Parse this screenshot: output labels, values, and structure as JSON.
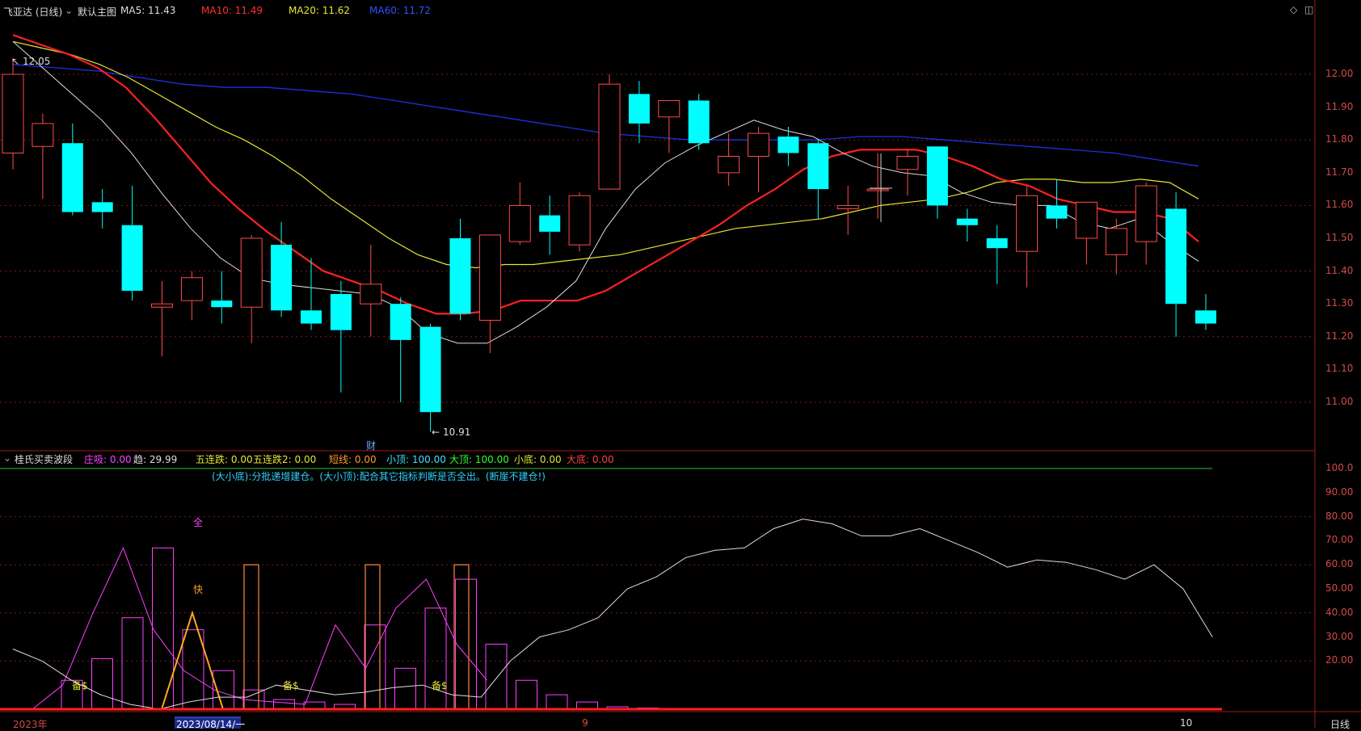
{
  "colors": {
    "up": "#ff4a4a",
    "down": "#00ffff",
    "ma5": "#dddddd",
    "ma10": "#ff2020",
    "ma20": "#e5e530",
    "ma60": "#2030e0",
    "grid": "#7a1a1a",
    "bg": "#000000"
  },
  "header": {
    "stock": "飞亚达 (日线)",
    "main_chart": "默认主图",
    "ma5_label": "MA5: 11.43",
    "ma10_label": "MA10: 11.49",
    "ma20_label": "MA20: 11.62",
    "ma60_label": "MA60: 11.72",
    "top_right_icons": [
      "diamond-icon",
      "panel-toggle-icon"
    ]
  },
  "price_annotations": {
    "high": "12.05",
    "low": "10.91",
    "finance_marker": "财"
  },
  "price_axis": [
    "12.00",
    "11.90",
    "11.80",
    "11.70",
    "11.60",
    "11.50",
    "11.40",
    "11.30",
    "11.20",
    "11.10",
    "11.00"
  ],
  "indicator": {
    "name": "桂氏买卖波段",
    "zhuangxi_label": "庄吸:",
    "zhuangxi_value": "0.00",
    "qu_label": "趋:",
    "qu_value": "29.99",
    "wlz_label": "五连跌:",
    "wlz_value": "0.00",
    "wlz2_label": "五连跌2:",
    "wlz2_value": "0.00",
    "dx_label": "短线:",
    "dx_value": "0.00",
    "xd_label": "小顶:",
    "xd_value": "100.00",
    "dd_label": "大顶:",
    "dd_value": "100.00",
    "xdi_label": "小底:",
    "xdi_value": "0.00",
    "ddi_label": "大底:",
    "ddi_value": "0.00",
    "note": "(大小底):分批递增建仓。(大小顶):配合其它指标判断是否全出。(断崖不建仓!)",
    "marker_quan": "全",
    "marker_kuai": "快",
    "marker_bei": "备$"
  },
  "indicator_axis": [
    "100.0",
    "90.00",
    "80.00",
    "70.00",
    "60.00",
    "50.00",
    "40.00",
    "30.00",
    "20.00"
  ],
  "bottom_bar": {
    "year": "2023年",
    "date_cursor": "2023/08/14/一",
    "month_9": "9",
    "month_10": "10",
    "period": "日线"
  },
  "chart_data": {
    "type": "candlestick",
    "candles": [
      {
        "o": 11.76,
        "h": 12.05,
        "l": 11.71,
        "c": 12.0
      },
      {
        "o": 11.78,
        "h": 11.88,
        "l": 11.62,
        "c": 11.85
      },
      {
        "o": 11.79,
        "h": 11.85,
        "l": 11.57,
        "c": 11.58
      },
      {
        "o": 11.61,
        "h": 11.65,
        "l": 11.53,
        "c": 11.58
      },
      {
        "o": 11.54,
        "h": 11.66,
        "l": 11.31,
        "c": 11.34
      },
      {
        "o": 11.29,
        "h": 11.37,
        "l": 11.14,
        "c": 11.3
      },
      {
        "o": 11.31,
        "h": 11.4,
        "l": 11.25,
        "c": 11.38
      },
      {
        "o": 11.31,
        "h": 11.4,
        "l": 11.24,
        "c": 11.29
      },
      {
        "o": 11.29,
        "h": 11.51,
        "l": 11.18,
        "c": 11.5
      },
      {
        "o": 11.48,
        "h": 11.55,
        "l": 11.26,
        "c": 11.28
      },
      {
        "o": 11.28,
        "h": 11.44,
        "l": 11.22,
        "c": 11.24
      },
      {
        "o": 11.33,
        "h": 11.37,
        "l": 11.03,
        "c": 11.22
      },
      {
        "o": 11.3,
        "h": 11.48,
        "l": 11.2,
        "c": 11.36
      },
      {
        "o": 11.3,
        "h": 11.32,
        "l": 11.0,
        "c": 11.19
      },
      {
        "o": 11.23,
        "h": 11.24,
        "l": 10.91,
        "c": 10.97
      },
      {
        "o": 11.5,
        "h": 11.56,
        "l": 11.25,
        "c": 11.27
      },
      {
        "o": 11.25,
        "h": 11.51,
        "l": 11.15,
        "c": 11.51
      },
      {
        "o": 11.49,
        "h": 11.67,
        "l": 11.48,
        "c": 11.6
      },
      {
        "o": 11.57,
        "h": 11.63,
        "l": 11.45,
        "c": 11.52
      },
      {
        "o": 11.48,
        "h": 11.64,
        "l": 11.46,
        "c": 11.63
      },
      {
        "o": 11.65,
        "h": 12.0,
        "l": 11.65,
        "c": 11.97
      },
      {
        "o": 11.94,
        "h": 11.98,
        "l": 11.79,
        "c": 11.85
      },
      {
        "o": 11.87,
        "h": 11.92,
        "l": 11.76,
        "c": 11.92
      },
      {
        "o": 11.92,
        "h": 11.94,
        "l": 11.77,
        "c": 11.79
      },
      {
        "o": 11.7,
        "h": 11.82,
        "l": 11.66,
        "c": 11.75
      },
      {
        "o": 11.75,
        "h": 11.84,
        "l": 11.64,
        "c": 11.82
      },
      {
        "o": 11.81,
        "h": 11.84,
        "l": 11.72,
        "c": 11.76
      },
      {
        "o": 11.79,
        "h": 11.8,
        "l": 11.56,
        "c": 11.65
      },
      {
        "o": 11.59,
        "h": 11.66,
        "l": 11.51,
        "c": 11.6
      },
      {
        "o": 11.65,
        "h": 11.76,
        "l": 11.56,
        "c": 11.65
      },
      {
        "o": 11.71,
        "h": 11.77,
        "l": 11.63,
        "c": 11.75
      },
      {
        "o": 11.78,
        "h": 11.78,
        "l": 11.56,
        "c": 11.6
      },
      {
        "o": 11.56,
        "h": 11.59,
        "l": 11.49,
        "c": 11.54
      },
      {
        "o": 11.5,
        "h": 11.54,
        "l": 11.36,
        "c": 11.47
      },
      {
        "o": 11.46,
        "h": 11.66,
        "l": 11.35,
        "c": 11.63
      },
      {
        "o": 11.6,
        "h": 11.68,
        "l": 11.53,
        "c": 11.56
      },
      {
        "o": 11.5,
        "h": 11.61,
        "l": 11.42,
        "c": 11.61
      },
      {
        "o": 11.45,
        "h": 11.56,
        "l": 11.39,
        "c": 11.53
      },
      {
        "o": 11.49,
        "h": 11.67,
        "l": 11.42,
        "c": 11.66
      },
      {
        "o": 11.59,
        "h": 11.64,
        "l": 11.2,
        "c": 11.3
      },
      {
        "o": 11.28,
        "h": 11.33,
        "l": 11.22,
        "c": 11.24
      }
    ],
    "ma5": [
      12.1,
      12.02,
      11.94,
      11.86,
      11.76,
      11.64,
      11.53,
      11.44,
      11.38,
      11.36,
      11.35,
      11.34,
      11.33,
      11.29,
      11.21,
      11.18,
      11.18,
      11.23,
      11.29,
      11.37,
      11.53,
      11.65,
      11.73,
      11.78,
      11.82,
      11.86,
      11.83,
      11.81,
      11.76,
      11.72,
      11.7,
      11.69,
      11.64,
      11.61,
      11.6,
      11.6,
      11.55,
      11.53,
      11.56,
      11.49,
      11.43
    ],
    "ma10": [
      12.12,
      12.09,
      12.06,
      12.02,
      11.96,
      11.87,
      11.77,
      11.67,
      11.59,
      11.52,
      11.46,
      11.4,
      11.37,
      11.34,
      11.3,
      11.27,
      11.27,
      11.28,
      11.31,
      11.31,
      11.31,
      11.34,
      11.39,
      11.44,
      11.49,
      11.54,
      11.6,
      11.65,
      11.71,
      11.75,
      11.77,
      11.77,
      11.77,
      11.75,
      11.72,
      11.68,
      11.66,
      11.62,
      11.6,
      11.58,
      11.58,
      11.56,
      11.49
    ],
    "ma20": [
      12.1,
      12.08,
      12.06,
      12.03,
      11.99,
      11.94,
      11.89,
      11.84,
      11.8,
      11.75,
      11.69,
      11.62,
      11.56,
      11.5,
      11.45,
      11.42,
      11.41,
      11.42,
      11.42,
      11.43,
      11.44,
      11.45,
      11.47,
      11.49,
      11.51,
      11.53,
      11.54,
      11.55,
      11.56,
      11.58,
      11.6,
      11.61,
      11.62,
      11.64,
      11.67,
      11.68,
      11.68,
      11.67,
      11.67,
      11.68,
      11.67,
      11.62
    ],
    "ma60": [
      12.03,
      12.02,
      12.01,
      11.99,
      11.97,
      11.96,
      11.96,
      11.95,
      11.94,
      11.92,
      11.9,
      11.88,
      11.86,
      11.84,
      11.82,
      11.81,
      11.8,
      11.8,
      11.8,
      11.8,
      11.81,
      11.81,
      11.8,
      11.79,
      11.78,
      11.77,
      11.76,
      11.74,
      11.72
    ],
    "ind_line": [
      25,
      20,
      12,
      6,
      2,
      0,
      3,
      5,
      5,
      10,
      8,
      6,
      7,
      9,
      10,
      6,
      5,
      20,
      30,
      33,
      38,
      50,
      55,
      63,
      66,
      67,
      75,
      79,
      77,
      72,
      72,
      75,
      70,
      65,
      59,
      62,
      61,
      58,
      54,
      60,
      50,
      30
    ],
    "ind_bars_magenta": [
      12,
      21,
      38,
      67,
      33,
      16,
      8,
      4,
      3,
      2,
      35,
      17,
      42,
      54,
      27,
      12,
      6,
      3,
      1,
      0.5
    ],
    "ind_bars_orange": [
      60,
      60,
      60,
      60
    ],
    "ind_line_magenta": [
      0,
      10,
      40,
      67,
      33,
      16,
      8,
      4,
      3,
      2,
      35,
      17,
      42,
      54,
      27,
      12
    ],
    "ind_line_orange": [
      0,
      40,
      0
    ],
    "ind_zero_level": 0,
    "ind_top_level": 100
  }
}
